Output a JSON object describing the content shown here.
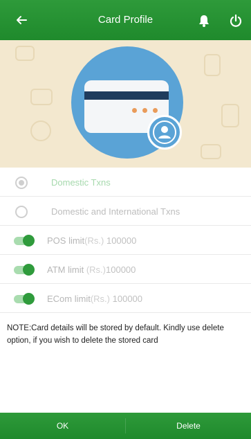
{
  "header": {
    "title": "Card Profile",
    "back_icon": "arrow-left-icon",
    "bell_icon": "bell-icon",
    "power_icon": "power-icon"
  },
  "options": {
    "domestic_label": "Domestic Txns",
    "domestic_international_label": "Domestic and International Txns",
    "selected": "domestic"
  },
  "limits": [
    {
      "name": "POS limit",
      "unit": "(Rs.)",
      "value": "100000",
      "enabled": true
    },
    {
      "name": "ATM limit",
      "unit": "(Rs.)",
      "value": "100000",
      "enabled": true
    },
    {
      "name": "ECom limit",
      "unit": "(Rs.)",
      "value": "100000",
      "enabled": true
    }
  ],
  "note": "NOTE:Card details will be stored by default. Kindly use delete option, if you wish to delete the stored card",
  "footer": {
    "ok_label": "OK",
    "delete_label": "Delete"
  },
  "colors": {
    "primary_green": "#1f8a2c",
    "banner_bg": "#f3e8cf",
    "illustration_blue": "#5aa3d6"
  }
}
